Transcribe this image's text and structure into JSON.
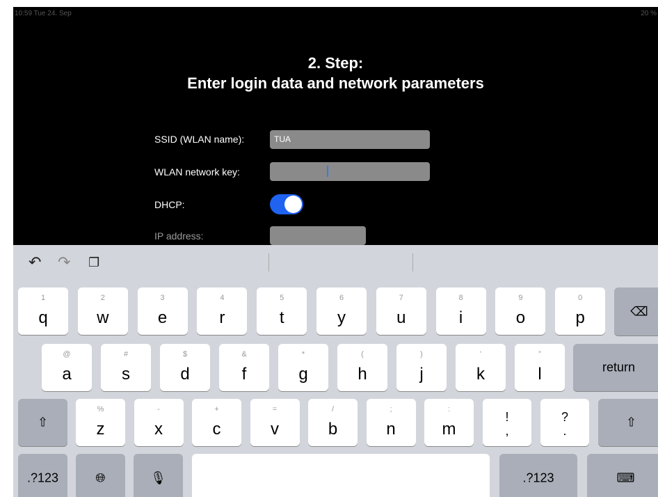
{
  "status_bar": {
    "time": "10:59  Tue 24. Sep",
    "right": "20 %"
  },
  "screen": {
    "title_line1": "2. Step:",
    "title_line2": "Enter login data and network parameters",
    "fields": [
      {
        "label": "SSID (WLAN name):",
        "value": "TUA"
      },
      {
        "label": "WLAN network key:",
        "value": ""
      },
      {
        "label": "DHCP:",
        "toggle_on": true
      },
      {
        "label": "IP address:",
        "value": ""
      }
    ]
  },
  "keyboard": {
    "toolbar_icons": [
      "undo-icon",
      "redo-icon",
      "paste-icon"
    ],
    "rows": [
      [
        {
          "h": "1",
          "k": "q"
        },
        {
          "h": "2",
          "k": "w"
        },
        {
          "h": "3",
          "k": "e"
        },
        {
          "h": "4",
          "k": "r"
        },
        {
          "h": "5",
          "k": "t"
        },
        {
          "h": "6",
          "k": "y"
        },
        {
          "h": "7",
          "k": "u"
        },
        {
          "h": "8",
          "k": "i"
        },
        {
          "h": "9",
          "k": "o"
        },
        {
          "h": "0",
          "k": "p"
        }
      ],
      [
        {
          "h": "@",
          "k": "a"
        },
        {
          "h": "#",
          "k": "s"
        },
        {
          "h": "$",
          "k": "d"
        },
        {
          "h": "&",
          "k": "f"
        },
        {
          "h": "*",
          "k": "g"
        },
        {
          "h": "(",
          "k": "h"
        },
        {
          "h": ")",
          "k": "j"
        },
        {
          "h": "’",
          "k": "k"
        },
        {
          "h": "”",
          "k": "l"
        }
      ],
      [
        {
          "h": "%",
          "k": "z"
        },
        {
          "h": "-",
          "k": "x"
        },
        {
          "h": "+",
          "k": "c"
        },
        {
          "h": "=",
          "k": "v"
        },
        {
          "h": "/",
          "k": "b"
        },
        {
          "h": ";",
          "k": "n"
        },
        {
          "h": ":",
          "k": "m"
        }
      ]
    ],
    "punct_keys": [
      "!\n,",
      "?\n."
    ],
    "return_label": "return",
    "numbers_label": ".?123",
    "accent_color": "#1f63f0"
  }
}
